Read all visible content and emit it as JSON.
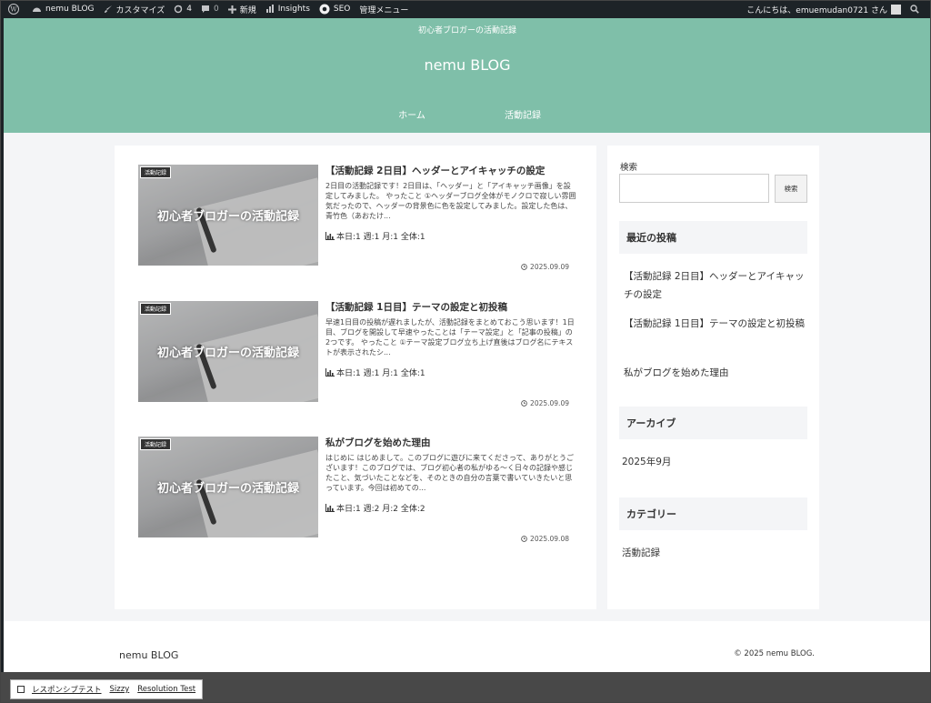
{
  "adminbar": {
    "site_name": "nemu BLOG",
    "customize": "カスタマイズ",
    "updates_count": "4",
    "comments_count": "0",
    "new": "新規",
    "insights": "Insights",
    "seo": "SEO",
    "admin_menu": "管理メニュー",
    "greeting": "こんにちは、emuemudan0721 さん"
  },
  "header": {
    "tagline": "初心者ブロガーの活動記録",
    "site_title": "nemu BLOG",
    "nav": [
      {
        "label": "ホーム"
      },
      {
        "label": "活動記録"
      }
    ]
  },
  "posts": [
    {
      "category": "活動記録",
      "thumb_text": "初心者ブロガーの活動記録",
      "title": "【活動記録 2日目】ヘッダーとアイキャッチの設定",
      "excerpt": "2日目の活動記録です！2日目は、「ヘッダー」と「アイキャッチ画像」を設定してみました。 やったこと ①ヘッダーブログ全体がモノクロで寂しい雰囲気だったので、ヘッダーの背景色に色を設定してみました。設定した色は、青竹色（あおたけ...",
      "views": "本日:1 週:1 月:1 全体:1",
      "date": "2025.09.09"
    },
    {
      "category": "活動記録",
      "thumb_text": "初心者ブロガーの活動記録",
      "title": "【活動記録 1日目】テーマの設定と初投稿",
      "excerpt": "早速1日目の投稿が遅れましたが、活動記録をまとめておこう思います！1日目、ブログを開設して早速やったことは「テーマ設定」と「記事の投稿」の2つです。 やったこと ①テーマ設定ブログ立ち上げ直後はブログ名にテキストが表示されたシ...",
      "views": "本日:1 週:1 月:1 全体:1",
      "date": "2025.09.09"
    },
    {
      "category": "活動記録",
      "thumb_text": "初心者ブロガーの活動記録",
      "title": "私がブログを始めた理由",
      "excerpt": "はじめに はじめまして。このブログに遊びに来てくださって、ありがとうございます！このブログでは、ブログ初心者の私がゆる〜く日々の記録や感じたこと、気づいたことなどを、そのときの自分の言葉で書いていきたいと思っています。今回は初めての...",
      "views": "本日:1 週:2 月:2 全体:2",
      "date": "2025.09.08"
    }
  ],
  "sidebar": {
    "search_label": "検索",
    "search_value": "",
    "search_button": "検索",
    "recent_heading": "最近の投稿",
    "recent_posts": [
      {
        "label": "【活動記録 2日目】ヘッダーとアイキャッチの設定"
      },
      {
        "label": "【活動記録 1日目】テーマの設定と初投稿"
      },
      {
        "label": "私がブログを始めた理由"
      }
    ],
    "archive_heading": "アーカイブ",
    "archives": [
      {
        "label": "2025年9月"
      }
    ],
    "category_heading": "カテゴリー",
    "categories": [
      {
        "label": "活動記録"
      }
    ]
  },
  "footer": {
    "site_title": "nemu BLOG",
    "copyright": "© 2025 nemu BLOG."
  },
  "devtools": {
    "responsive_test": "レスポンシブテスト",
    "sizzy": "Sizzy",
    "resolution_test": "Resolution Test"
  },
  "colors": {
    "header_bg": "#7fbfa9",
    "admin_bg": "#1d2327"
  }
}
